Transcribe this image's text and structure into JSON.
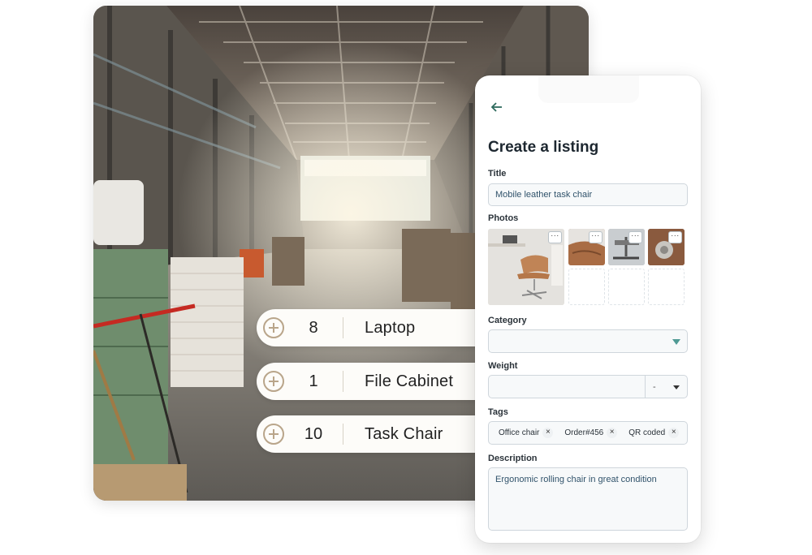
{
  "inventory": [
    {
      "qty": "8",
      "name": "Laptop"
    },
    {
      "qty": "1",
      "name": "File Cabinet"
    },
    {
      "qty": "10",
      "name": "Task Chair"
    }
  ],
  "listing": {
    "heading": "Create a listing",
    "back_icon": "arrow-left-icon",
    "title_label": "Title",
    "title_value": "Mobile leather task chair",
    "photos_label": "Photos",
    "photo_menu_glyph": "···",
    "category_label": "Category",
    "category_value": "",
    "weight_label": "Weight",
    "weight_value": "",
    "weight_unit": "-",
    "tags_label": "Tags",
    "tags": [
      {
        "label": "Office chair"
      },
      {
        "label": "Order#456"
      },
      {
        "label": "QR coded"
      }
    ],
    "tag_remove_glyph": "×",
    "description_label": "Description",
    "description_value": "Ergonomic rolling chair in great condition"
  },
  "colors": {
    "accent_teal": "#4f9a94",
    "field_text": "#31536b",
    "plus_icon": "#b9a58a"
  }
}
